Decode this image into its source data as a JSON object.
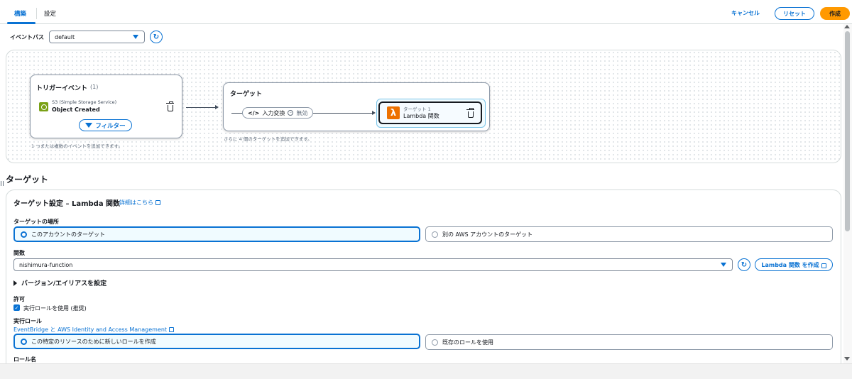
{
  "tabs": [
    {
      "label": "構築"
    },
    {
      "label": "設定"
    }
  ],
  "header_actions": {
    "cancel": "キャンセル",
    "reset": "リセット",
    "create": "作成"
  },
  "event_bus": {
    "label": "イベントバス",
    "value": "default"
  },
  "canvas": {
    "trigger": {
      "title": "トリガーイベント",
      "count": "(1)",
      "service": "S3 (Simple Storage Service)",
      "event": "Object Created",
      "filter_label": "フィルター",
      "hint": "1 つまたは複数のイベントを追加できます。"
    },
    "target_group": {
      "title": "ターゲット",
      "transform_label": "入力変換",
      "transform_status": "無効",
      "target_number": "ターゲット 1",
      "target_name": "Lambda 関数",
      "hint": "さらに 4 個のターゲットを追加できます。"
    }
  },
  "section": {
    "title": "ターゲット",
    "panel_title": "ターゲット設定 – Lambda 関数",
    "info_link": "詳細はこちら",
    "location_label": "ターゲットの場所",
    "location_options": [
      {
        "label": "このアカウントのターゲット",
        "selected": true
      },
      {
        "label": "別の AWS アカウントのターゲット",
        "selected": false
      }
    ],
    "function_label": "関数",
    "function_value": "nishimura-function",
    "create_lambda": "Lambda 関数 を作成",
    "version_alias": "バージョン/エイリアスを設定",
    "permission_label": "許可",
    "use_role_checkbox": "実行ロールを使用 (推奨)",
    "role_label": "実行ロール",
    "role_link": "EventBridge と AWS Identity and Access Management",
    "role_options": [
      {
        "label": "この特定のリソースのために新しいロールを作成",
        "selected": true
      },
      {
        "label": "既存のロールを使用",
        "selected": false
      }
    ],
    "role_name_label": "ロール名"
  },
  "colors": {
    "accent": "#0972d3",
    "primary_button": "#ff9900",
    "s3": "#7aa116",
    "lambda": "#ed7100"
  }
}
